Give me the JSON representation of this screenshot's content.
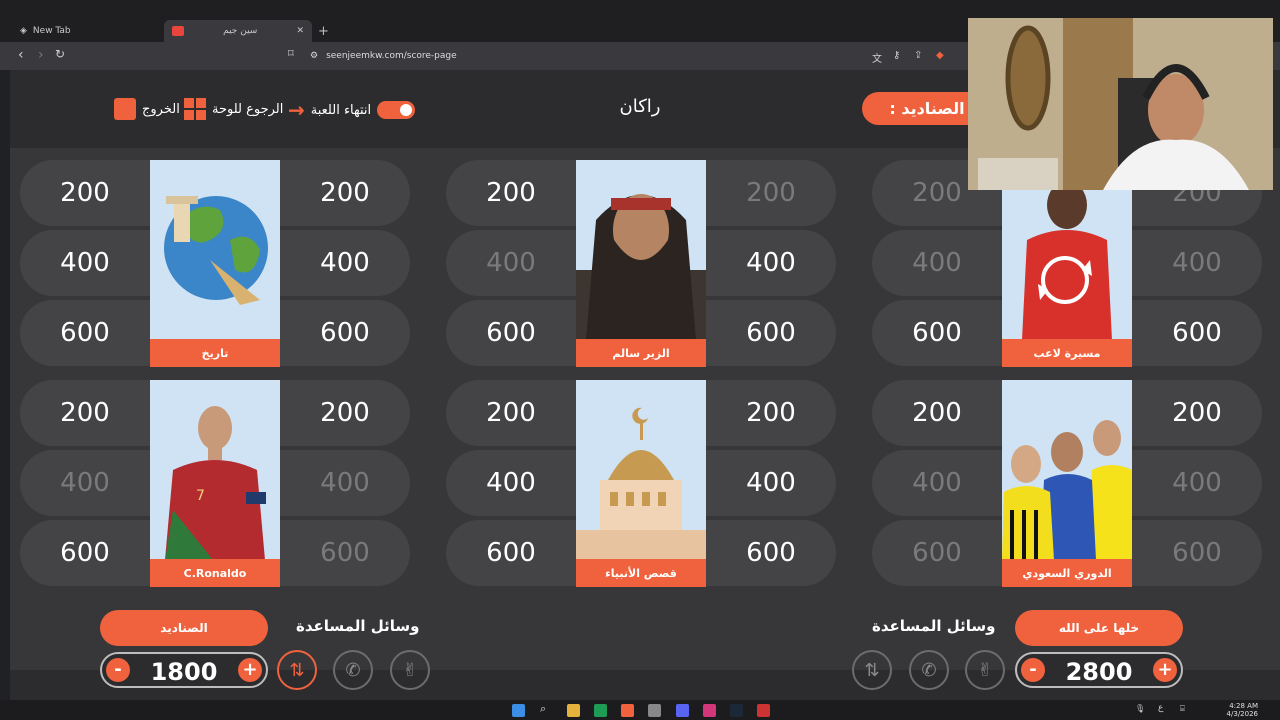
{
  "browser": {
    "tabs": [
      {
        "title": "New Tab",
        "active": false
      },
      {
        "title": "سين جيم",
        "active": true
      }
    ],
    "url": "seenjeemkw.com/score-page"
  },
  "topbar": {
    "exit_label": "الخروج",
    "back_label": "الرجوع للوحة",
    "end_label": "انتهاء اللعبة",
    "turn_name": "راكان",
    "current_team": ": الصناديد"
  },
  "categories": [
    {
      "label": "تاريخ",
      "left": [
        "200",
        "400",
        "600"
      ],
      "right": [
        "200",
        "400",
        "600"
      ],
      "left_used": [
        false,
        false,
        false
      ],
      "right_used": [
        false,
        false,
        false
      ]
    },
    {
      "label": "الزير سالم",
      "left": [
        "200",
        "400",
        "600"
      ],
      "right": [
        "200",
        "400",
        "600"
      ],
      "left_used": [
        false,
        true,
        false
      ],
      "right_used": [
        true,
        false,
        false
      ]
    },
    {
      "label": "مسيرة لاعب",
      "left": [
        "200",
        "400",
        "600"
      ],
      "right": [
        "200",
        "400",
        "600"
      ],
      "left_used": [
        true,
        true,
        false
      ],
      "right_used": [
        true,
        true,
        false
      ]
    },
    {
      "label": "C.Ronaldo",
      "left": [
        "200",
        "400",
        "600"
      ],
      "right": [
        "200",
        "400",
        "600"
      ],
      "left_used": [
        false,
        true,
        false
      ],
      "right_used": [
        false,
        true,
        true
      ]
    },
    {
      "label": "قصص الأنبياء",
      "left": [
        "200",
        "400",
        "600"
      ],
      "right": [
        "200",
        "400",
        "600"
      ],
      "left_used": [
        false,
        false,
        false
      ],
      "right_used": [
        false,
        false,
        false
      ]
    },
    {
      "label": "الدوري السعودي",
      "left": [
        "200",
        "400",
        "600"
      ],
      "right": [
        "200",
        "400",
        "600"
      ],
      "left_used": [
        false,
        true,
        true
      ],
      "right_used": [
        false,
        true,
        true
      ]
    }
  ],
  "teams": [
    {
      "name": "الصناديد",
      "score": "1800",
      "help_title": "وسائل المساعدة"
    },
    {
      "name": "خلها على الله",
      "score": "2800",
      "help_title": "وسائل المساعدة"
    }
  ],
  "controls": {
    "minus": "-",
    "plus": "+"
  },
  "taskbar": {
    "time": "4:28 AM",
    "date": "4/3/2026",
    "lang": "ع"
  },
  "colors": {
    "accent": "#f0623d",
    "pill": "#444447",
    "bg": "#2c2c2e"
  }
}
